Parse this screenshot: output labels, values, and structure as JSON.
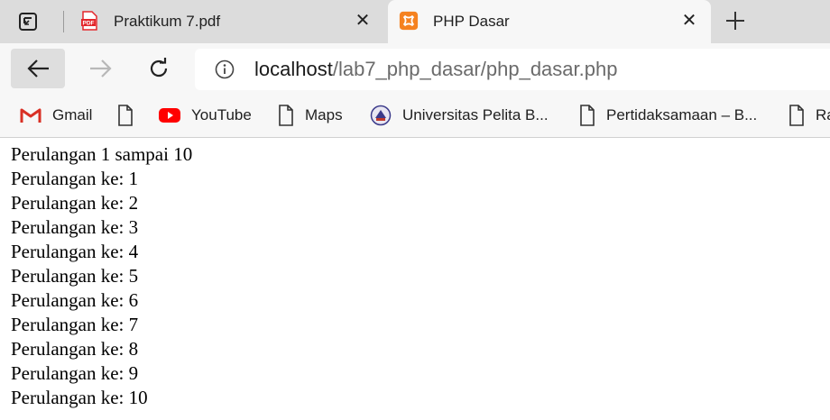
{
  "tabs": [
    {
      "title": "Praktikum 7.pdf",
      "icon": "pdf-file-icon",
      "active": false,
      "icon_text": "PDF"
    },
    {
      "title": "PHP Dasar",
      "icon": "xampp-icon",
      "active": true
    }
  ],
  "address_bar": {
    "host": "localhost",
    "path": "/lab7_php_dasar/php_dasar.php"
  },
  "bookmarks": [
    {
      "label": "Gmail",
      "icon": "gmail-icon"
    },
    {
      "label": "",
      "icon": "page-icon"
    },
    {
      "label": "YouTube",
      "icon": "youtube-icon"
    },
    {
      "label": "Maps",
      "icon": "page-icon"
    },
    {
      "label": "Universitas Pelita B...",
      "icon": "university-seal-icon"
    },
    {
      "label": "Pertidaksamaan – B...",
      "icon": "page-icon"
    },
    {
      "label": "Ra",
      "icon": "page-icon"
    }
  ],
  "page": {
    "heading": "Perulangan 1 sampai 10",
    "lines": [
      "Perulangan ke: 1",
      "Perulangan ke: 2",
      "Perulangan ke: 3",
      "Perulangan ke: 4",
      "Perulangan ke: 5",
      "Perulangan ke: 6",
      "Perulangan ke: 7",
      "Perulangan ke: 8",
      "Perulangan ke: 9",
      "Perulangan ke: 10"
    ]
  },
  "colors": {
    "tabstrip": "#dcdcdc",
    "toolbar": "#f7f7f7",
    "pdf_red": "#e3262b",
    "xampp_orange": "#f58220",
    "youtube_red": "#ff0000"
  }
}
